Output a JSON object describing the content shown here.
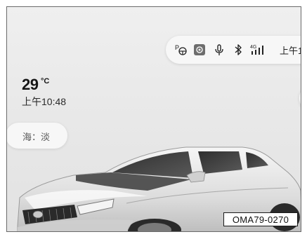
{
  "status_bar": {
    "park_assist": "P",
    "camera_icon": "camera-icon",
    "mic_icon": "microphone-icon",
    "bluetooth_icon": "bluetooth-icon",
    "signal_label": "4G",
    "time": "上午1"
  },
  "weather": {
    "temperature": "29",
    "unit": "°C",
    "time": "上午10:48",
    "air_quality": "海：淡"
  },
  "figure": {
    "code": "OMA79-0270"
  }
}
